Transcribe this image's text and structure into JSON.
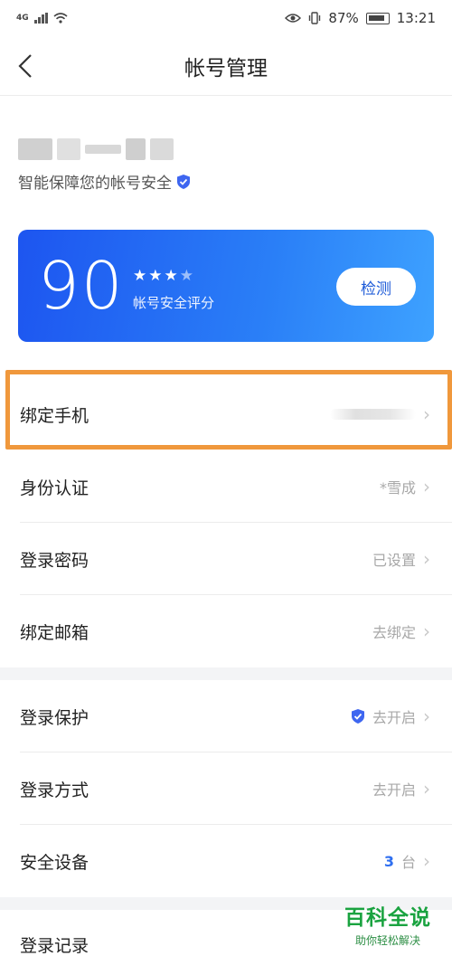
{
  "status_bar": {
    "network": "4G",
    "battery_percent": "87%",
    "time": "13:21"
  },
  "header": {
    "title": "帐号管理"
  },
  "account": {
    "subtitle": "智能保障您的帐号安全"
  },
  "score_card": {
    "score": "90",
    "stars_filled": 3,
    "stars_total": 4,
    "label": "帐号安全评分",
    "check_button": "检测"
  },
  "rows": {
    "bind_phone": {
      "label": "绑定手机",
      "value": ""
    },
    "identity": {
      "label": "身份认证",
      "value": "*雪成"
    },
    "login_password": {
      "label": "登录密码",
      "value": "已设置"
    },
    "bind_email": {
      "label": "绑定邮箱",
      "value": "去绑定"
    },
    "login_protection": {
      "label": "登录保护",
      "value": "去开启"
    },
    "login_method": {
      "label": "登录方式",
      "value": "去开启"
    },
    "security_devices": {
      "label": "安全设备",
      "count": "3",
      "unit": "台"
    },
    "login_records": {
      "label": "登录记录"
    }
  },
  "watermark": {
    "title": "百科全说",
    "subtitle": "助你轻松解决"
  },
  "colors": {
    "accent_blue": "#2a6ff2",
    "highlight_orange": "#f0983c",
    "watermark_green": "#1aa340"
  }
}
